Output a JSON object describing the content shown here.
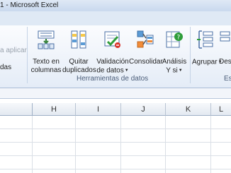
{
  "window": {
    "title": "1 - Microsoft Excel"
  },
  "ribbon": {
    "left_fragments": {
      "reapply": "a aplicar",
      "advanced": "das"
    },
    "buttons": {
      "text_to_columns": {
        "line1": "Texto en",
        "line2": "columnas"
      },
      "remove_duplicates": {
        "line1": "Quitar",
        "line2": "duplicados"
      },
      "data_validation": {
        "line1": "Validación",
        "line2": "de datos"
      },
      "consolidate": {
        "line1": "Consolidar"
      },
      "what_if": {
        "line1": "Análisis",
        "line2": "Y si"
      },
      "group": {
        "line1": "Agrupar"
      },
      "ungroup_partial": {
        "line1": "Des"
      }
    },
    "groups": {
      "data_tools": "Herramientas de datos",
      "outline_partial": "Es"
    }
  },
  "sheet": {
    "columns": [
      "H",
      "I",
      "J",
      "K",
      "L",
      ""
    ]
  },
  "colors": {
    "ribbon_bg": "#e4ecf7",
    "group_label": "#4a5c78",
    "grid_line": "#dadfe6"
  }
}
